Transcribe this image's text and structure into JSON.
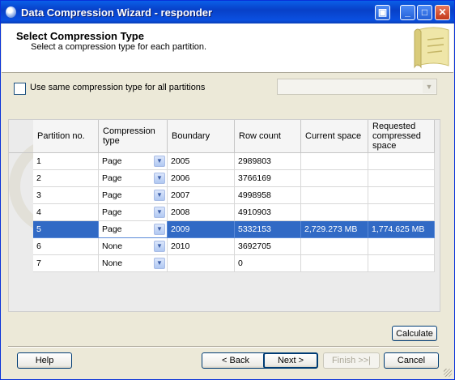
{
  "window": {
    "title": "Data Compression Wizard - responder"
  },
  "header": {
    "title": "Select Compression Type",
    "subtitle": "Select a compression type for each partition."
  },
  "same_type": {
    "label": "Use same compression type for all partitions",
    "checked": false,
    "combo_value": ""
  },
  "grid": {
    "columns": [
      "Partition no.",
      "Compression type",
      "Boundary",
      "Row count",
      "Current space",
      "Requested compressed space"
    ],
    "rows": [
      {
        "partition": "1",
        "type": "Page",
        "boundary": "2005",
        "row_count": "2989803",
        "current_space": "",
        "requested_space": ""
      },
      {
        "partition": "2",
        "type": "Page",
        "boundary": "2006",
        "row_count": "3766169",
        "current_space": "",
        "requested_space": ""
      },
      {
        "partition": "3",
        "type": "Page",
        "boundary": "2007",
        "row_count": "4998958",
        "current_space": "",
        "requested_space": ""
      },
      {
        "partition": "4",
        "type": "Page",
        "boundary": "2008",
        "row_count": "4910903",
        "current_space": "",
        "requested_space": ""
      },
      {
        "partition": "5",
        "type": "Page",
        "boundary": "2009",
        "row_count": "5332153",
        "current_space": "2,729.273 MB",
        "requested_space": "1,774.625 MB"
      },
      {
        "partition": "6",
        "type": "None",
        "boundary": "2010",
        "row_count": "3692705",
        "current_space": "",
        "requested_space": ""
      },
      {
        "partition": "7",
        "type": "None",
        "boundary": "",
        "row_count": "0",
        "current_space": "",
        "requested_space": ""
      }
    ],
    "selected_row": 4
  },
  "buttons": {
    "calculate": "Calculate",
    "help": "Help",
    "back": "< Back",
    "next": "Next >",
    "finish": "Finish >>|",
    "cancel": "Cancel"
  },
  "colors": {
    "title_bar": "#0a50e0",
    "selection": "#316ac5",
    "dialog_bg": "#ece9d8"
  }
}
